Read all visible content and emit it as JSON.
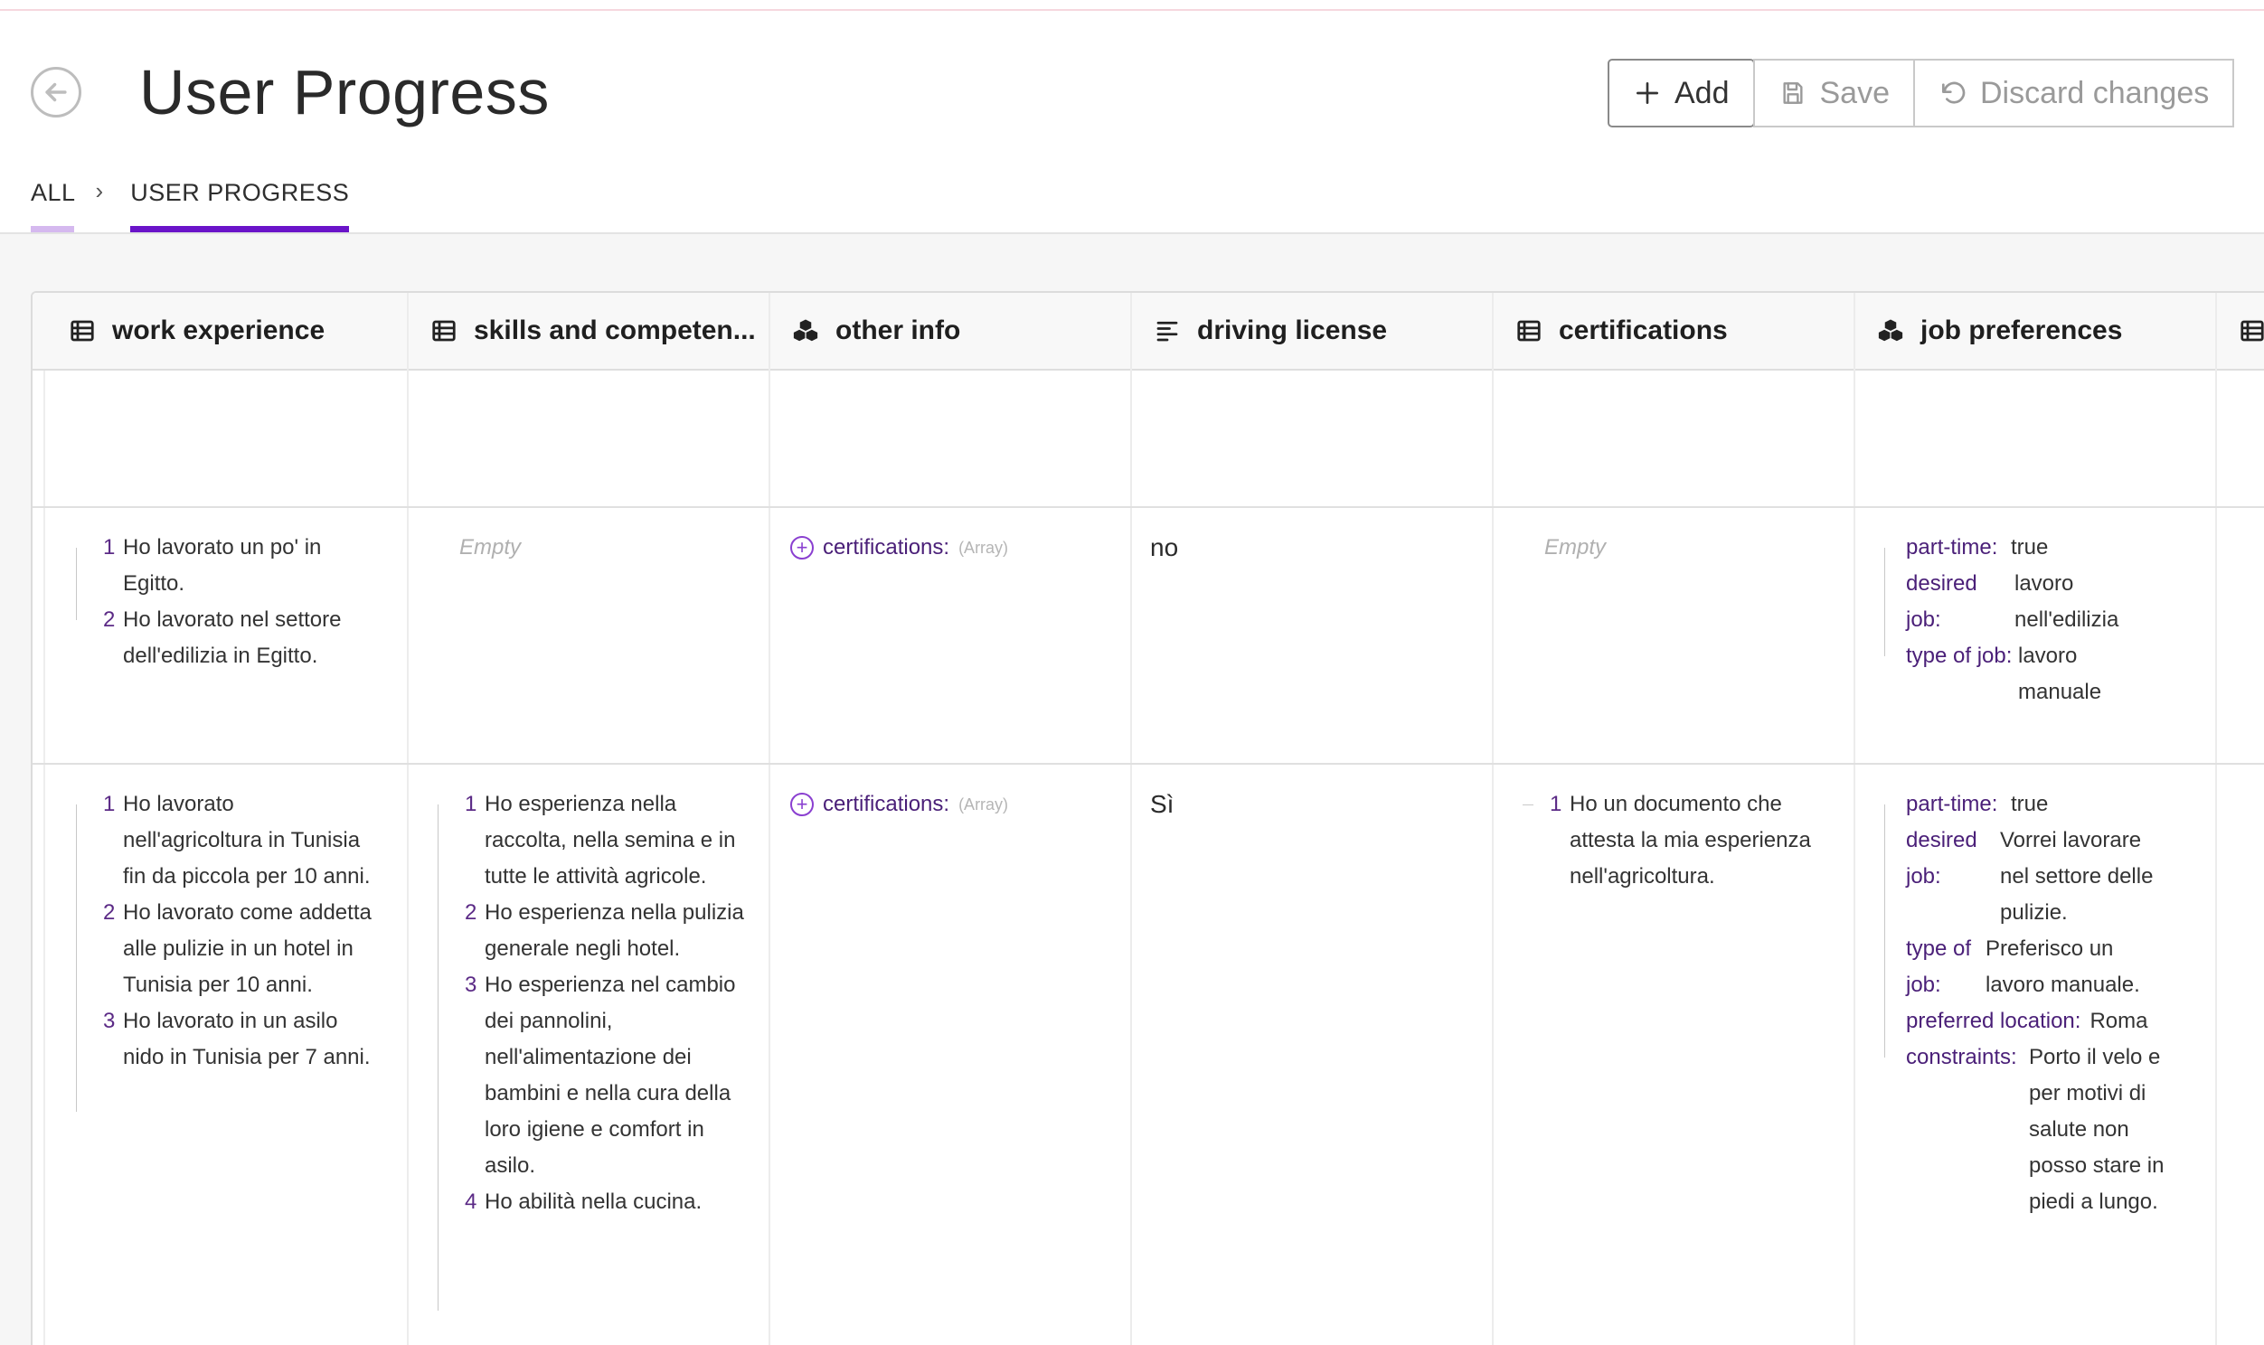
{
  "header": {
    "title": "User Progress",
    "buttons": {
      "add": "Add",
      "save": "Save",
      "discard": "Discard changes"
    }
  },
  "breadcrumb": {
    "all": "ALL",
    "current": "USER PROGRESS"
  },
  "columns": [
    {
      "label": "work experience",
      "icon": "table-icon"
    },
    {
      "label": "skills and competen...",
      "icon": "table-icon"
    },
    {
      "label": "other info",
      "icon": "object-icon"
    },
    {
      "label": "driving license",
      "icon": "text-icon"
    },
    {
      "label": "certifications",
      "icon": "table-icon"
    },
    {
      "label": "job preferences",
      "icon": "object-icon"
    }
  ],
  "rows": [
    {
      "work_experience": [
        {
          "n": "1",
          "text": "Ho lavorato un po' in Egitto."
        },
        {
          "n": "2",
          "text": "Ho lavorato nel settore dell'edilizia in Egitto."
        }
      ],
      "skills_empty": "Empty",
      "other_info": {
        "key": "certifications:",
        "type": "(Array)"
      },
      "driving_license": "no",
      "certifications_empty": "Empty",
      "job_preferences": [
        {
          "key": "part-time:",
          "value": "true"
        },
        {
          "key": "desired job:",
          "value": "lavoro nell'edilizia"
        },
        {
          "key": "type of job:",
          "value": "lavoro manuale"
        }
      ]
    },
    {
      "work_experience": [
        {
          "n": "1",
          "text": "Ho lavorato nell'agricoltura in Tunisia fin da piccola per 10 anni."
        },
        {
          "n": "2",
          "text": "Ho lavorato come addetta alle pulizie in un hotel in Tunisia per 10 anni."
        },
        {
          "n": "3",
          "text": "Ho lavorato in un asilo nido in Tunisia per 7 anni."
        }
      ],
      "skills": [
        {
          "n": "1",
          "text": "Ho esperienza nella raccolta, nella semina e in tutte le attività agricole."
        },
        {
          "n": "2",
          "text": "Ho esperienza nella pulizia generale negli hotel."
        },
        {
          "n": "3",
          "text": "Ho esperienza nel cambio dei pannolini, nell'alimentazione dei bambini e nella cura della loro igiene e comfort in asilo."
        },
        {
          "n": "4",
          "text": "Ho abilità nella cucina."
        }
      ],
      "other_info": {
        "key": "certifications:",
        "type": "(Array)"
      },
      "driving_license": "Sì",
      "certifications": [
        {
          "n": "1",
          "text": "Ho un documento che attesta la mia esperienza nell'agricoltura."
        }
      ],
      "job_preferences": [
        {
          "key": "part-time:",
          "value": "true"
        },
        {
          "key": "desired job:",
          "value": "Vorrei lavorare nel settore delle pulizie."
        },
        {
          "key": "type of job:",
          "value": "Preferisco un lavoro manuale."
        },
        {
          "key": "preferred location:",
          "value": "Roma"
        },
        {
          "key": "constraints:",
          "value": "Porto il velo e per motivi di salute non posso stare in piedi a lungo."
        }
      ]
    }
  ]
}
